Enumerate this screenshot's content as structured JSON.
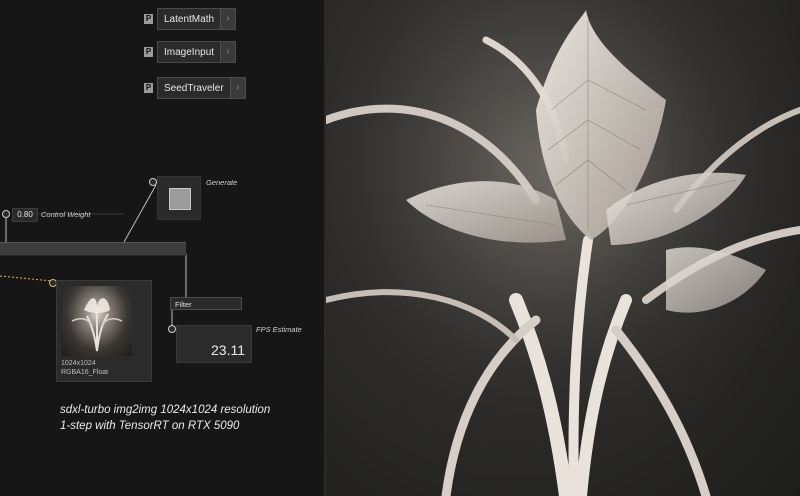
{
  "operators": [
    {
      "pin": "P",
      "name": "LatentMath"
    },
    {
      "pin": "P",
      "name": "ImageInput"
    },
    {
      "pin": "P",
      "name": "SeedTraveler"
    }
  ],
  "generate": {
    "label": "Generate"
  },
  "control_weight": {
    "value": "0.80",
    "label": "Control Weight"
  },
  "thumbnail": {
    "resolution": "1024x1024",
    "format": "RGBA16_Float"
  },
  "filter": {
    "label": "Filter"
  },
  "fps": {
    "label": "FPS Estimate",
    "value": "23.11"
  },
  "caption": {
    "line1": "sdxl-turbo img2img 1024x1024 resolution",
    "line2": "1-step with TensorRT on RTX 5090"
  },
  "chevron_glyph": "›",
  "icons": [
    "chevron-right-icon",
    "flower-sculpture-image"
  ]
}
